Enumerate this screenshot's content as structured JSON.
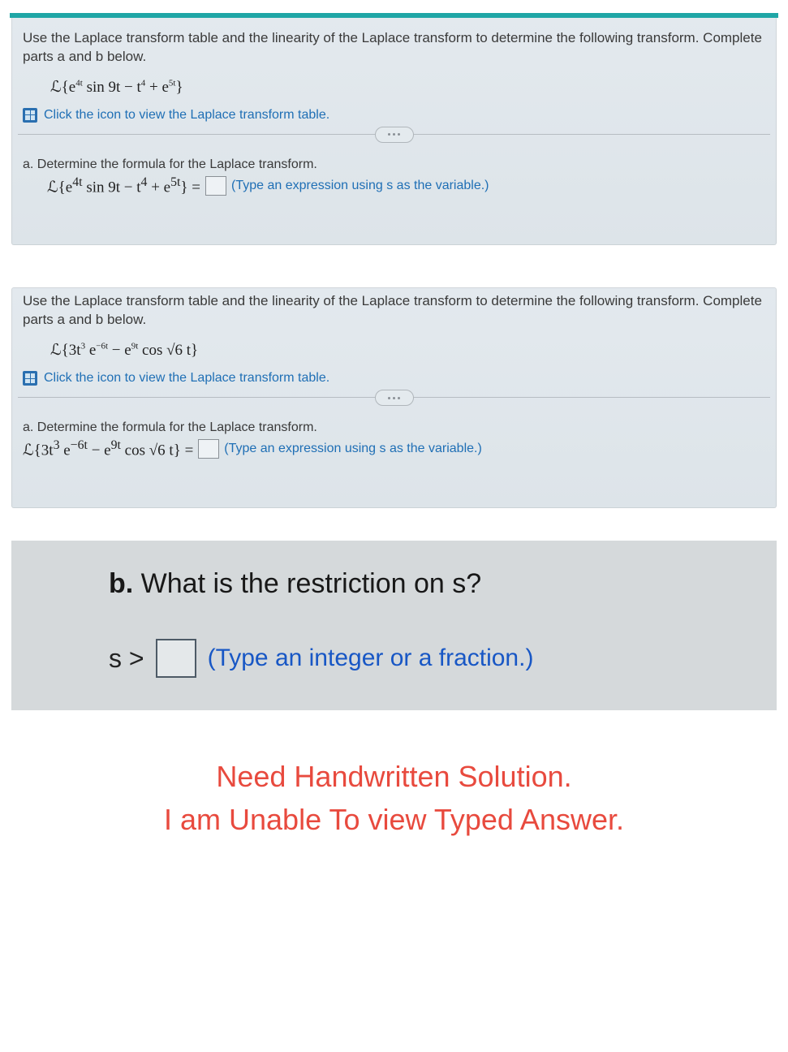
{
  "problem1": {
    "instruction": "Use the Laplace transform table and the linearity of the Laplace transform to determine the following transform. Complete parts a and b below.",
    "expression_html": "ℒ{e<sup>4t</sup> sin 9t − t<sup>4</sup> + e<sup>5t</sup>}",
    "link_text": "Click the icon to view the Laplace transform table.",
    "part_a_label": "a. Determine the formula for the Laplace transform.",
    "part_a_expr_html": "ℒ{e<sup>4t</sup> sin 9t − t<sup>4</sup> + e<sup>5t</sup>} =",
    "part_a_hint": "(Type an expression using s as the variable.)"
  },
  "problem2": {
    "instruction": "Use the Laplace transform table and the linearity of the Laplace transform to determine the following transform. Complete parts a and b below.",
    "expression_html": "ℒ{3t<sup>3</sup> e<sup>−6t</sup> − e<sup>9t</sup> cos √6 t}",
    "link_text": "Click the icon to view the Laplace transform table.",
    "part_a_label": "a. Determine the formula for the Laplace transform.",
    "part_a_expr_html": "ℒ{3t<sup>3</sup> e<sup>−6t</sup> − e<sup>9t</sup> cos √6 t} =",
    "part_a_hint": "(Type an expression using s as the variable.)"
  },
  "part_b": {
    "title_prefix": "b.",
    "title_rest": " What is the restriction on s?",
    "lhs": "s >",
    "hint": "(Type an integer or a fraction.)"
  },
  "note_line1": "Need Handwritten Solution.",
  "note_line2": "I am Unable To view Typed Answer."
}
